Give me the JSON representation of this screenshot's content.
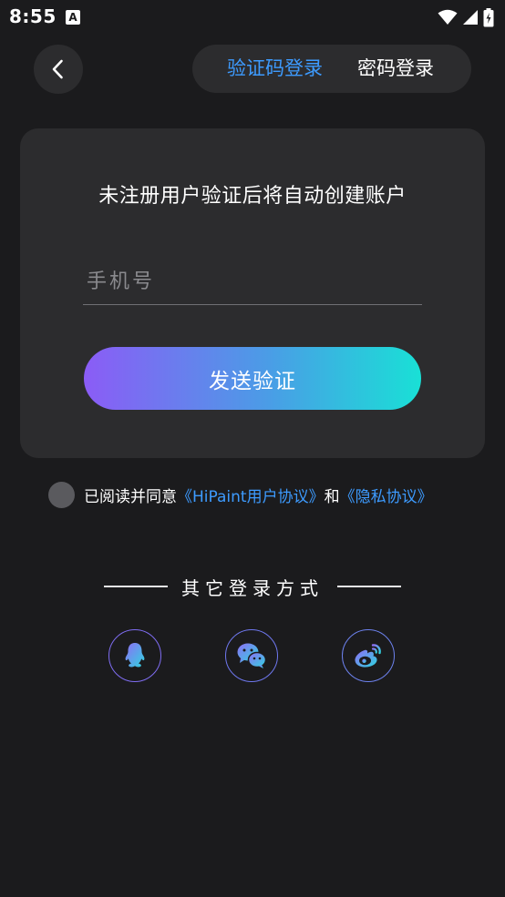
{
  "status_bar": {
    "time": "8:55",
    "notification_badge": "A"
  },
  "header": {
    "tabs": [
      {
        "label": "验证码登录",
        "active": true
      },
      {
        "label": "密码登录",
        "active": false
      }
    ]
  },
  "card": {
    "hint": "未注册用户验证后将自动创建账户",
    "phone_placeholder": "手机号",
    "phone_value": "",
    "send_button_label": "发送验证"
  },
  "agreement": {
    "prefix": "已阅读并同意",
    "user_agreement_link": "《HiPaint用户协议》",
    "conjunction": "和",
    "privacy_link": "《隐私协议》",
    "checked": false
  },
  "other_login": {
    "title": "其它登录方式",
    "methods": [
      "qq-icon",
      "wechat-icon",
      "weibo-icon"
    ]
  },
  "colors": {
    "background": "#1b1b1d",
    "panel": "#2c2c2e",
    "accent_blue": "#3d9bff",
    "gradient_start": "#8b5cf6",
    "gradient_end": "#19e0d6"
  }
}
